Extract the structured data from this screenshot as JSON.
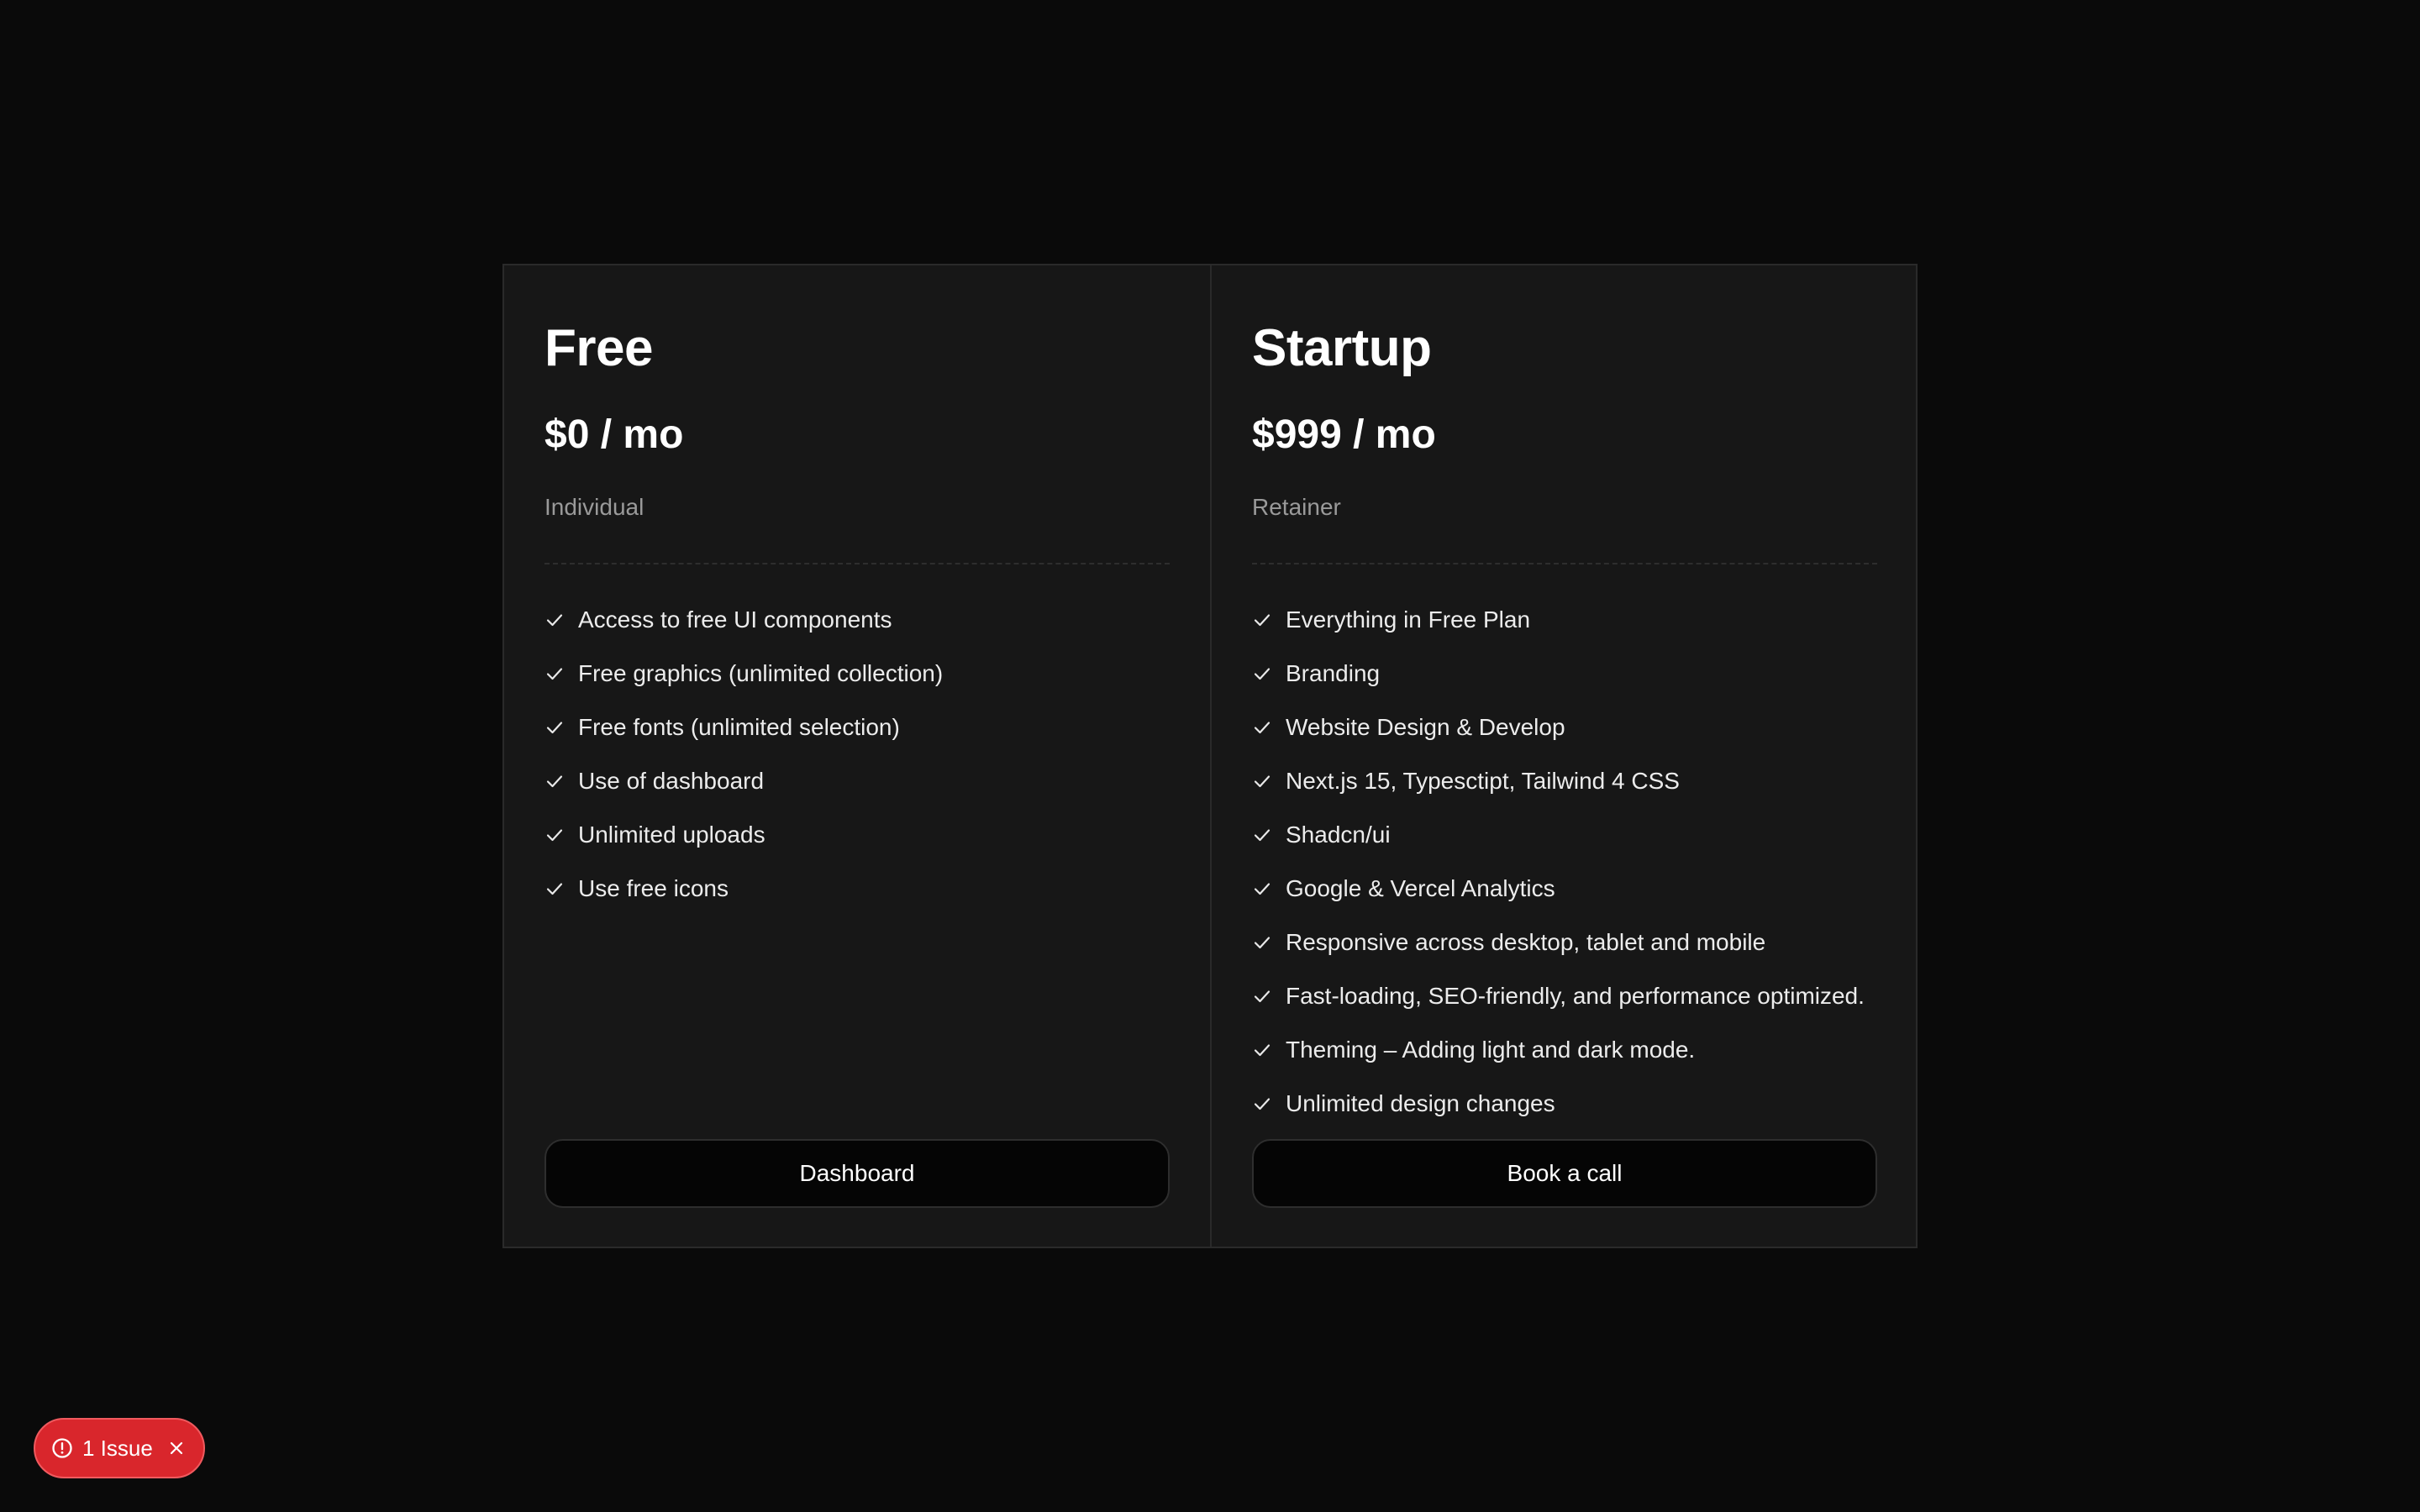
{
  "plans": [
    {
      "name": "Free",
      "price": "$0 / mo",
      "type": "Individual",
      "features": [
        "Access to free UI components",
        "Free graphics (unlimited collection)",
        "Free fonts (unlimited selection)",
        "Use of dashboard",
        "Unlimited uploads",
        "Use free icons"
      ],
      "button_label": "Dashboard"
    },
    {
      "name": "Startup",
      "price": "$999 / mo",
      "type": "Retainer",
      "features": [
        "Everything in Free Plan",
        "Branding",
        "Website Design & Develop",
        "Next.js 15, Typesctipt, Tailwind 4 CSS",
        "Shadcn/ui",
        "Google & Vercel Analytics",
        "Responsive across desktop, tablet and mobile",
        "Fast-loading, SEO-friendly, and performance optimized.",
        "Theming – Adding light and dark mode.",
        "Unlimited design changes"
      ],
      "button_label": "Book a call"
    }
  ],
  "issue_badge": {
    "label": "1 Issue",
    "icon": "alert-circle-icon",
    "close_icon": "close-icon"
  },
  "colors": {
    "background": "#0a0a0a",
    "card": "#171717",
    "border": "#2a2a2a",
    "button": "#050505",
    "issue_badge": "#d9262c"
  }
}
